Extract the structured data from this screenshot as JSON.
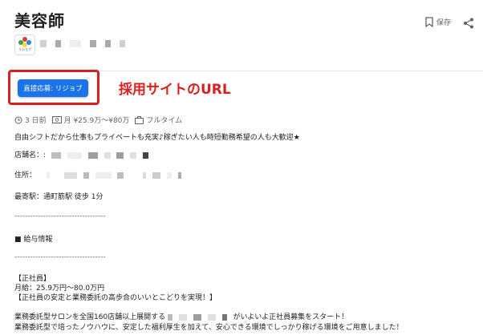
{
  "job": {
    "title": "美容師",
    "logo_text": "リジョブ",
    "save_label": "保存"
  },
  "apply": {
    "button_label": "直接応募: リジョブ",
    "annotation": "採用サイトのURL"
  },
  "meta": {
    "posted": "3 日前",
    "salary": "月 ¥25.9万～¥80万",
    "type": "フルタイム"
  },
  "description": {
    "line1": "自由シフトだから仕事もプライベートも充実♪稼ぎたい人も時短勤務希望の人も大歓迎★",
    "store_label": "店舗名：:",
    "address_label": "住所：",
    "station": "最寄駅：通町筋駅 徒歩 1分",
    "separator1": "-----------------------------------",
    "section_heading": "■ 給与情報",
    "separator2": "-----------------------------------",
    "emp_type": "【正社員】",
    "monthly": "月給：25.9万円～80.0万円",
    "tagline": "【正社員の安定と業務委託の高歩合のいいとこどりを実現！】",
    "para1_a": "業務委託型サロンを全国160店舗以上展開する",
    "para1_b": "がいよいよ正社員募集をスタート！",
    "para2": "業務委託型で培ったノウハウに、安定した福利厚生を加えて、安心できる環境でしっかり稼げる環境をご用意しました！"
  },
  "colors": {
    "accent": "#1a73e8",
    "annotation_red": "#d92020"
  }
}
